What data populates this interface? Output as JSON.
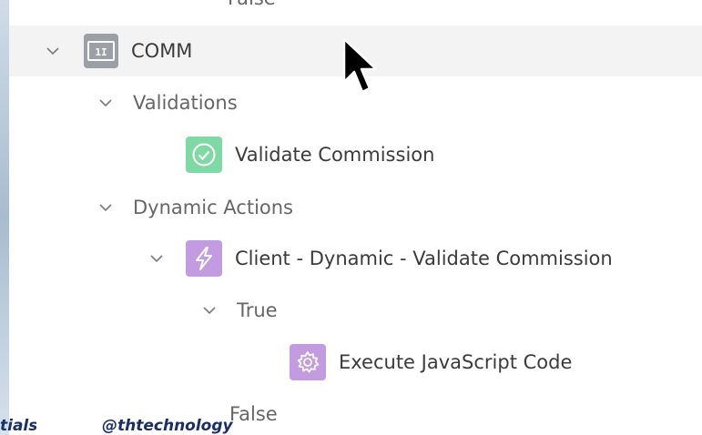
{
  "tree": {
    "top_partial": "False",
    "item": {
      "label": "COMM",
      "icon": "page-item-icon",
      "badge": "1I"
    },
    "validations_group": {
      "label": "Validations"
    },
    "validation": {
      "label": "Validate Commission",
      "icon": "check-circle-icon"
    },
    "dynamic_actions_group": {
      "label": "Dynamic Actions"
    },
    "dynamic_action": {
      "label": "Client - Dynamic - Validate Commission",
      "icon": "lightning-icon"
    },
    "true_group": {
      "label": "True"
    },
    "action": {
      "label": "Execute JavaScript Code",
      "icon": "gear-icon"
    },
    "false_group": {
      "label": "False"
    }
  },
  "footer": {
    "left_text": "tials",
    "center_text": "@thtechnology"
  },
  "colors": {
    "validation_icon_bg": "#7fd9a5",
    "dynamic_action_icon_bg": "#c39be0",
    "item_icon_bg": "#9aa0a6",
    "footer_text": "#1a2e6b"
  }
}
